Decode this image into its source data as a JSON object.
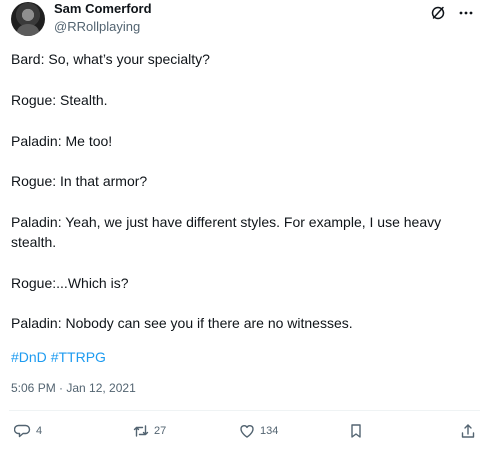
{
  "author": {
    "name": "Sam Comerford",
    "handle": "@RRollplaying"
  },
  "tweet": {
    "lines": [
      "Bard: So, what’s your specialty?",
      "Rogue: Stealth.",
      "Paladin: Me too!",
      "Rogue: In that armor?",
      "Paladin: Yeah, we just have different styles. For example, I use heavy",
      "stealth.",
      "Rogue:...Which is?",
      "Paladin: Nobody can see you if there are no witnesses."
    ],
    "hashtags": [
      "#DnD",
      "#TTRPG"
    ],
    "timestamp": "5:06 PM · Jan 12, 2021"
  },
  "actions": {
    "replies": "4",
    "reposts": "27",
    "likes": "134"
  },
  "icons": {
    "avatar": "user-avatar",
    "grok": "grok-icon",
    "more": "more-icon",
    "reply": "reply-icon",
    "repost": "repost-icon",
    "like": "heart-icon",
    "bookmark": "bookmark-icon",
    "share": "share-icon"
  },
  "colors": {
    "text": "#0f1419",
    "secondary": "#536471",
    "link": "#1d9bf0",
    "divider": "#eff3f4"
  }
}
